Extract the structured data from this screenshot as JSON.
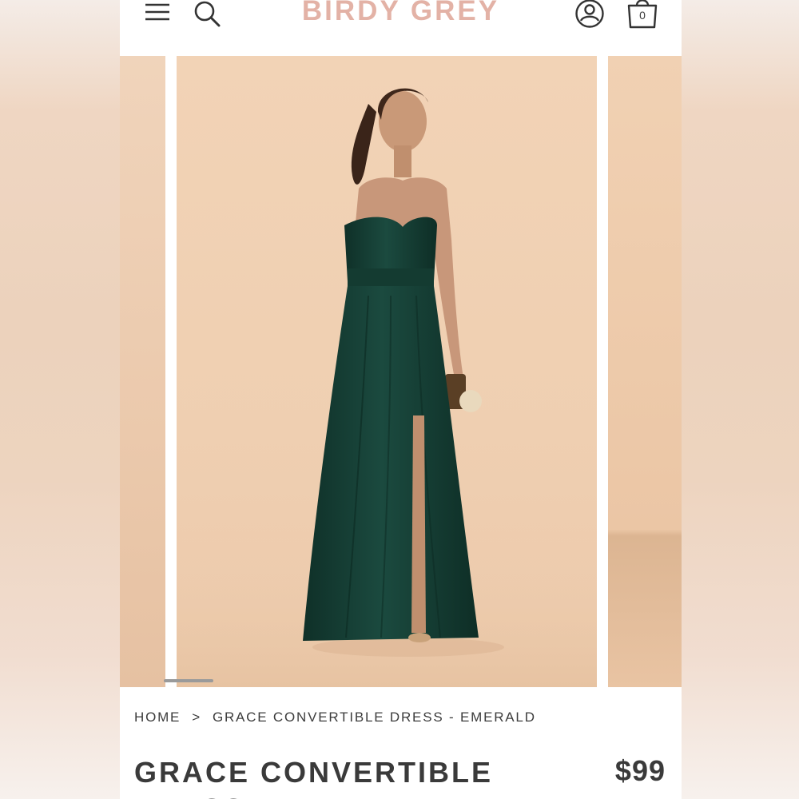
{
  "header": {
    "logo": "BIRDY GREY",
    "menu_icon": "hamburger-menu-icon",
    "search_icon": "search-icon",
    "account_icon": "user-account-icon",
    "cart_icon": "shopping-bag-icon",
    "cart_count": "0"
  },
  "gallery": {
    "images": [
      "previous-product-image",
      "model-emerald-dress-image",
      "next-product-image"
    ]
  },
  "breadcrumb": {
    "home": "HOME",
    "separator": ">",
    "current": "GRACE CONVERTIBLE DRESS - EMERALD"
  },
  "product": {
    "title": "GRACE CONVERTIBLE DRESS",
    "price": "$99"
  },
  "colors": {
    "logo": "#e3b2a6",
    "text": "#3a3a3a",
    "dress": "#163f35",
    "backdrop": "#efcfb1"
  }
}
